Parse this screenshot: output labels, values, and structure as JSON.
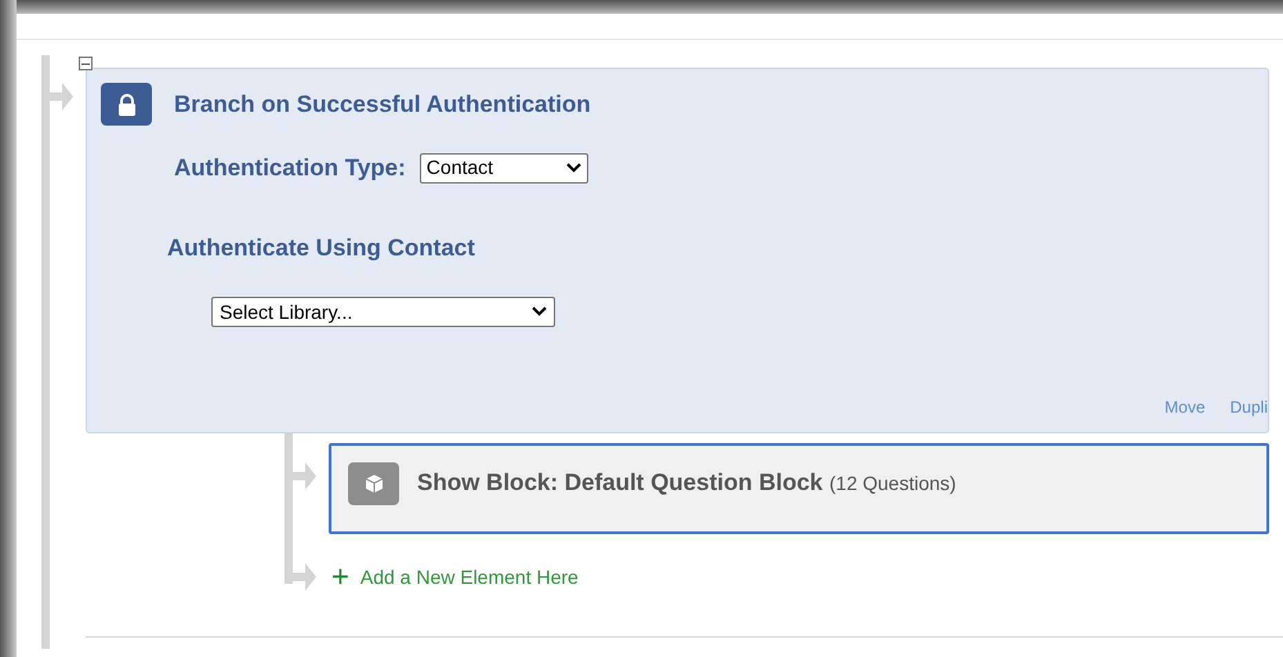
{
  "branch": {
    "title": "Branch on Successful Authentication",
    "expanded": true,
    "authentication_type": {
      "label": "Authentication Type:",
      "value": "Contact"
    },
    "section_title": "Authenticate Using Contact",
    "library_select": {
      "value": "Select Library..."
    },
    "actions": [
      "Move",
      "Dupli"
    ]
  },
  "block": {
    "title": "Show Block: Default Question Block",
    "count": "(12 Questions)",
    "selected": true
  },
  "add_element": {
    "icon": "+",
    "label": "Add a New Element Here"
  }
}
